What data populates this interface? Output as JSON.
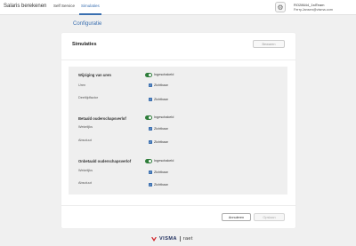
{
  "header": {
    "app_title": "Salaris berekenen",
    "tabs": [
      {
        "label": "Self Service"
      },
      {
        "label": "Simulaties"
      }
    ],
    "user": {
      "id": "RO28644_1stTeam",
      "email": "Ferry.Jansen@visma.com"
    }
  },
  "breadcrumb": "Configuratie",
  "panel": {
    "title": "Simulaties",
    "save_top_label": "Bewaren",
    "groups": [
      {
        "label": "Wijziging van uren",
        "toggle_label": "Ingeschakeld",
        "rows": [
          {
            "label": "Uren",
            "checkbox_label": "Zichtbaar"
          },
          {
            "label": "Deeltijdfactor",
            "checkbox_label": "Zichtbaar"
          }
        ]
      },
      {
        "label": "Betaald ouderschapsverlof",
        "toggle_label": "Ingeschakeld",
        "rows": [
          {
            "label": "Wekelijks",
            "checkbox_label": "Zichtbaar"
          },
          {
            "label": "Absoluut",
            "checkbox_label": "Zichtbaar"
          }
        ]
      },
      {
        "label": "Onbetaald ouderschapsverlof",
        "toggle_label": "Ingeschakeld",
        "rows": [
          {
            "label": "Wekelijks",
            "checkbox_label": "Zichtbaar"
          },
          {
            "label": "Absoluut",
            "checkbox_label": "Zichtbaar"
          }
        ]
      }
    ],
    "cancel_label": "Annuleren",
    "save_label": "Opslaan"
  },
  "footer": {
    "brand": "VISMA",
    "sub_brand": "raet"
  },
  "colors": {
    "accent": "#3a6fb0",
    "toggle_on": "#2e7d3a"
  }
}
